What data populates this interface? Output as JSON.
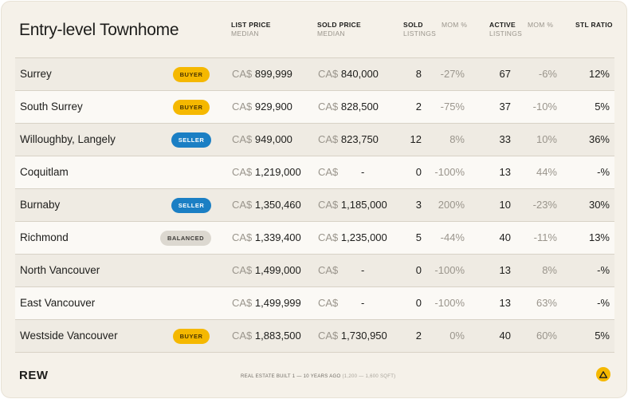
{
  "title": "Entry-level Townhome",
  "columns": {
    "list_price": {
      "main": "LIST PRICE",
      "sub": "MEDIAN"
    },
    "sold_price": {
      "main": "SOLD PRICE",
      "sub": "MEDIAN"
    },
    "sold_listings": {
      "main": "SOLD",
      "sub": "LISTINGS"
    },
    "sold_mom": {
      "sub": "MOM %"
    },
    "active_listings": {
      "main": "ACTIVE",
      "sub": "LISTINGS"
    },
    "active_mom": {
      "sub": "MOM %"
    },
    "stl_ratio": {
      "main": "STL RATIO"
    }
  },
  "currency": "CA$",
  "rows": [
    {
      "name": "Surrey",
      "badge": "BUYER",
      "badge_type": "buyer",
      "list": "899,999",
      "sold": "840,000",
      "sold_n": "8",
      "sold_mom": "-27%",
      "active_n": "67",
      "active_mom": "-6%",
      "stl": "12%"
    },
    {
      "name": "South Surrey",
      "badge": "BUYER",
      "badge_type": "buyer",
      "list": "929,900",
      "sold": "828,500",
      "sold_n": "2",
      "sold_mom": "-75%",
      "active_n": "37",
      "active_mom": "-10%",
      "stl": "5%"
    },
    {
      "name": "Willoughby, Langely",
      "badge": "SELLER",
      "badge_type": "seller",
      "list": "949,000",
      "sold": "823,750",
      "sold_n": "12",
      "sold_mom": "8%",
      "active_n": "33",
      "active_mom": "10%",
      "stl": "36%"
    },
    {
      "name": "Coquitlam",
      "badge": "",
      "badge_type": "",
      "list": "1,219,000",
      "sold": "-",
      "sold_n": "0",
      "sold_mom": "-100%",
      "active_n": "13",
      "active_mom": "44%",
      "stl": "-%"
    },
    {
      "name": "Burnaby",
      "badge": "SELLER",
      "badge_type": "seller",
      "list": "1,350,460",
      "sold": "1,185,000",
      "sold_n": "3",
      "sold_mom": "200%",
      "active_n": "10",
      "active_mom": "-23%",
      "stl": "30%"
    },
    {
      "name": "Richmond",
      "badge": "BALANCED",
      "badge_type": "balanced",
      "list": "1,339,400",
      "sold": "1,235,000",
      "sold_n": "5",
      "sold_mom": "-44%",
      "active_n": "40",
      "active_mom": "-11%",
      "stl": "13%"
    },
    {
      "name": "North Vancouver",
      "badge": "",
      "badge_type": "",
      "list": "1,499,000",
      "sold": "-",
      "sold_n": "0",
      "sold_mom": "-100%",
      "active_n": "13",
      "active_mom": "8%",
      "stl": "-%"
    },
    {
      "name": "East Vancouver",
      "badge": "",
      "badge_type": "",
      "list": "1,499,999",
      "sold": "-",
      "sold_n": "0",
      "sold_mom": "-100%",
      "active_n": "13",
      "active_mom": "63%",
      "stl": "-%"
    },
    {
      "name": "Westside Vancouver",
      "badge": "BUYER",
      "badge_type": "buyer",
      "list": "1,883,500",
      "sold": "1,730,950",
      "sold_n": "2",
      "sold_mom": "0%",
      "active_n": "40",
      "active_mom": "60%",
      "stl": "5%"
    }
  ],
  "footer": {
    "logo": "REW",
    "note": "REAL ESTATE BUILT 1 — 10 YEARS AGO",
    "note_detail": "(1,200 — 1,600 SQFT)",
    "alert_icon": "warning-triangle-icon"
  },
  "colors": {
    "buyer": "#f5b800",
    "seller": "#1b7fc4",
    "balanced": "#dcd8d0",
    "background": "#f5f1e9"
  }
}
